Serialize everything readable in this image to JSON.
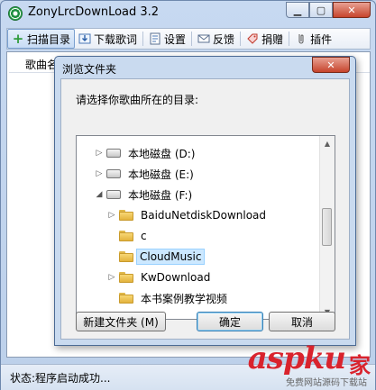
{
  "app": {
    "title": "ZonyLrcDownLoad 3.2"
  },
  "window_controls": {
    "minimize": "▁",
    "maximize": "▢",
    "close": "✕"
  },
  "toolbar": [
    {
      "label": "扫描目录",
      "icon": "plus-icon"
    },
    {
      "label": "下载歌词",
      "icon": "download-icon"
    },
    {
      "label": "设置",
      "icon": "settings-icon"
    },
    {
      "label": "反馈",
      "icon": "mail-icon"
    },
    {
      "label": "捐赠",
      "icon": "donate-icon"
    },
    {
      "label": "插件",
      "icon": "plugin-icon"
    }
  ],
  "list": {
    "column_song": "歌曲名"
  },
  "status": {
    "text": "状态:程序启动成功..."
  },
  "dialog": {
    "title": "浏览文件夹",
    "prompt": "请选择你歌曲所在的目录:",
    "tree": [
      {
        "label": "本地磁盘 (D:)",
        "type": "drive",
        "expander": "▷",
        "indent": 0
      },
      {
        "label": "本地磁盘 (E:)",
        "type": "drive",
        "expander": "▷",
        "indent": 0
      },
      {
        "label": "本地磁盘 (F:)",
        "type": "drive",
        "expander": "◢",
        "indent": 0
      },
      {
        "label": "BaiduNetdiskDownload",
        "type": "folder",
        "expander": "▷",
        "indent": 1
      },
      {
        "label": "c",
        "type": "folder",
        "expander": "",
        "indent": 1
      },
      {
        "label": "CloudMusic",
        "type": "folder",
        "expander": "",
        "indent": 1,
        "selected": true
      },
      {
        "label": "KwDownload",
        "type": "folder",
        "expander": "▷",
        "indent": 1
      },
      {
        "label": "本书案例教学视频",
        "type": "folder",
        "expander": "",
        "indent": 1
      }
    ],
    "buttons": {
      "new_folder": "新建文件夹 (M)",
      "ok": "确定",
      "cancel": "取消"
    },
    "close": "✕"
  },
  "watermark": {
    "text": "aspku",
    "han": "家",
    "sub": "免费网站源码下载站"
  }
}
